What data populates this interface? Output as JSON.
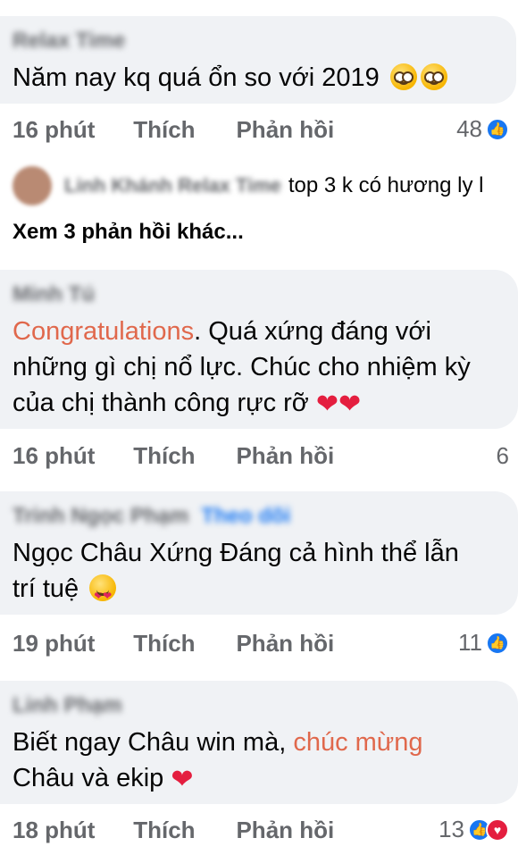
{
  "comments": [
    {
      "author": "Relax Time",
      "text_1": "Năm nay kq quá ổn so với 2019",
      "emojis": [
        "pleading-face-icon",
        "pleading-face-icon"
      ],
      "time": "16 phút",
      "like_label": "Thích",
      "reply_label": "Phản hồi",
      "reaction_count": "48",
      "reaction_icons": [
        "like-icon"
      ]
    },
    {
      "author": "Minh Tú",
      "text_accent": "Congratulations",
      "text_1_rest": ". Quá xứng đáng với",
      "text_2": "những gì chị nổ lực. Chúc cho nhiệm kỳ",
      "text_3": "của chị thành công rực rỡ",
      "emojis": [
        "heart-icon",
        "heart-icon"
      ],
      "time": "16 phút",
      "like_label": "Thích",
      "reply_label": "Phản hồi",
      "reaction_count": "6",
      "reaction_icons": []
    },
    {
      "author": "Trinh Ngọc Phạm",
      "follow": "Theo dõi",
      "text_1": "Ngọc Châu Xứng Đáng cả hình thể lẫn",
      "text_2": "trí tuệ",
      "emojis": [
        "heart-eyes-icon"
      ],
      "time": "19 phút",
      "like_label": "Thích",
      "reply_label": "Phản hồi",
      "reaction_count": "11",
      "reaction_icons": [
        "like-icon"
      ]
    },
    {
      "author": "Linh Phạm",
      "text_1_pre": "Biết ngay Châu win mà, ",
      "text_accent": "chúc mừng",
      "text_2": "Châu và ekip",
      "emojis": [
        "heart-icon"
      ],
      "time": "18 phút",
      "like_label": "Thích",
      "reply_label": "Phản hồi",
      "reaction_count": "13",
      "reaction_icons": [
        "like-icon",
        "love-icon"
      ]
    }
  ],
  "reply_preview": {
    "names": "Linh Khánh Relax Time",
    "text": "top 3 k có hương ly l"
  },
  "more_replies": "Xem 3 phản hồi khác...",
  "colors": {
    "bubble": "#f0f2f5",
    "meta_gray": "#65676b",
    "accent": "#e0684c",
    "like_blue": "#1877f2",
    "heart_red": "#e41e3f"
  }
}
